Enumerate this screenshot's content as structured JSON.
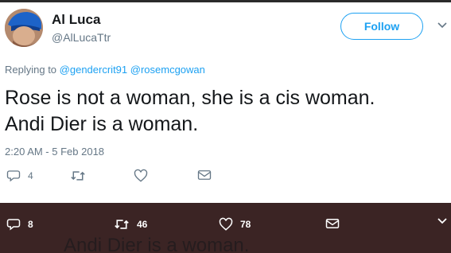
{
  "tweet": {
    "author_name": "Al Luca",
    "author_handle": "@AlLucaTtr",
    "follow_label": "Follow",
    "replying_prefix": "Replying to",
    "replying_to": [
      "@gendercrit91",
      "@rosemcgowan"
    ],
    "text_line1": "Rose is not a woman, she is a cis woman.",
    "text_line2": "Andi Dier is a woman.",
    "timestamp": "2:20 AM - 5 Feb 2018",
    "actions": {
      "reply_count": "4",
      "retweet_count": "",
      "like_count": "",
      "icons": [
        "reply-icon",
        "retweet-icon",
        "like-icon",
        "message-icon"
      ]
    }
  },
  "sticky_bar": {
    "reply_count": "8",
    "retweet_count": "46",
    "like_count": "78",
    "overlay_text": "Andi Dier is a woman.",
    "icons": [
      "reply-icon",
      "retweet-icon",
      "like-icon",
      "message-icon",
      "chevron-down-icon"
    ]
  },
  "colors": {
    "accent": "#1da1f2",
    "secondary_text": "#657786",
    "primary_text": "#14171a",
    "sticky_bar_bg": "#3b2424"
  }
}
